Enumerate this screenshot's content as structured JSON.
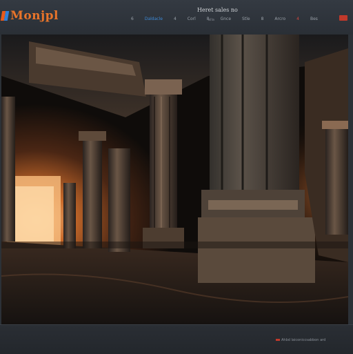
{
  "app": {
    "logo_text": "Monjpl",
    "title": "Heret sales no"
  },
  "toolbar": {
    "items": [
      "6",
      "Daldacle",
      "4",
      "Corl",
      "8",
      "Gnce",
      "Stle",
      "8",
      "Arcro",
      "4",
      "Bes"
    ],
    "sub_label": "alla"
  },
  "status": {
    "text": "Ahbd laiconiccsabbon ard"
  },
  "colors": {
    "accent": "#e8742a",
    "brand_blue": "#2f7fd8",
    "brand_red": "#c0392b"
  }
}
